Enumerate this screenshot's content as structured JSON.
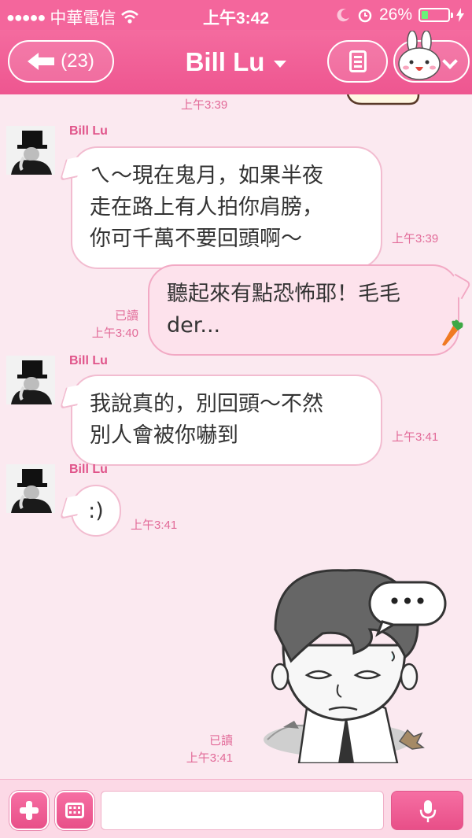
{
  "status_bar": {
    "carrier": "中華電信",
    "time": "上午3:42",
    "battery": "26%",
    "battery_level": 0.26
  },
  "header": {
    "back_label": "(23)",
    "title": "Bill Lu"
  },
  "messages": {
    "top_time": "上午3:39",
    "m1": {
      "sender": "Bill Lu",
      "lines": [
        "ㄟ～現在鬼月，如果半夜",
        "走在路上有人拍你肩膀，",
        "你可千萬不要回頭啊～"
      ],
      "time": "上午3:39"
    },
    "m2": {
      "lines": [
        "聽起來有點恐怖耶！毛毛",
        "der..."
      ],
      "read": "已讀",
      "time": "上午3:40"
    },
    "m3": {
      "sender": "Bill Lu",
      "lines": [
        "我說真的，別回頭～不然",
        "別人會被你嚇到"
      ],
      "time": "上午3:41"
    },
    "m4": {
      "sender": "Bill Lu",
      "text": ":)",
      "time": "上午3:41"
    },
    "m5": {
      "read": "已讀",
      "time": "上午3:41",
      "bubble_text": "•••"
    }
  },
  "input": {
    "placeholder": ""
  },
  "colors": {
    "accent": "#f4669c",
    "background": "#fbe9f0"
  }
}
